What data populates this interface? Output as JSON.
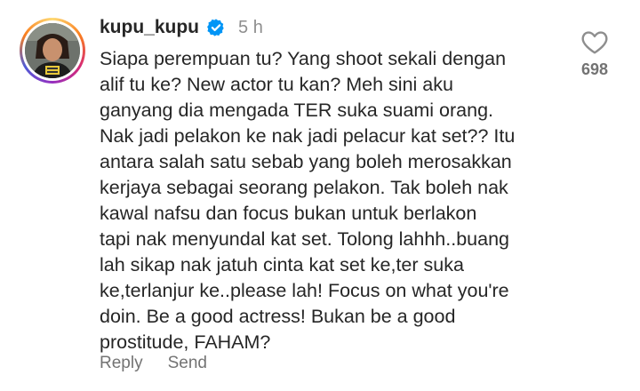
{
  "comment": {
    "username": "kupu_kupu",
    "time": "5 h",
    "verified_icon": "verified-badge-icon",
    "text": "Siapa perempuan tu? Yang shoot sekali dengan alif tu ke? New actor tu kan? Meh sini aku ganyang dia mengada TER suka suami orang. Nak jadi pelakon ke nak jadi pelacur kat set?? Itu antara salah satu sebab yang boleh merosakkan kerjaya sebagai seorang pelakon. Tak boleh nak kawal nafsu dan focus bukan untuk berlakon tapi nak menyundal kat set. Tolong lahhh..buang lah sikap nak jatuh cinta kat set ke,ter suka ke,terlanjur ke..please lah! Focus on what you're doin. Be a good actress! Bukan be a good prostitude, FAHAM?",
    "lines": [
      "Siapa perempuan tu? Yang shoot sekali dengan",
      "alif tu ke? New actor tu kan? Meh sini aku",
      "ganyang dia mengada TER suka suami orang.",
      "Nak jadi pelakon ke nak jadi pelacur kat set?? Itu",
      "antara salah satu sebab yang boleh merosakkan",
      "kerjaya sebagai seorang pelakon. Tak boleh nak",
      "kawal nafsu dan focus bukan untuk berlakon",
      "tapi nak menyundal kat set. Tolong lahhh..buang",
      "lah sikap nak jatuh cinta kat set ke,ter suka",
      "ke,terlanjur ke..please lah! Focus on what you're",
      "doin. Be a good actress! Bukan be a good",
      "prostitude, FAHAM?"
    ],
    "like_count": "698",
    "like_icon": "heart-outline-icon",
    "actions": {
      "reply": "Reply",
      "send": "Send"
    }
  },
  "colors": {
    "text": "#262626",
    "muted": "#8e8e8e",
    "verified": "#0095f6",
    "ring": [
      "#feda75",
      "#fa7e1e",
      "#d62976",
      "#962fbf",
      "#4f5bd5"
    ]
  }
}
